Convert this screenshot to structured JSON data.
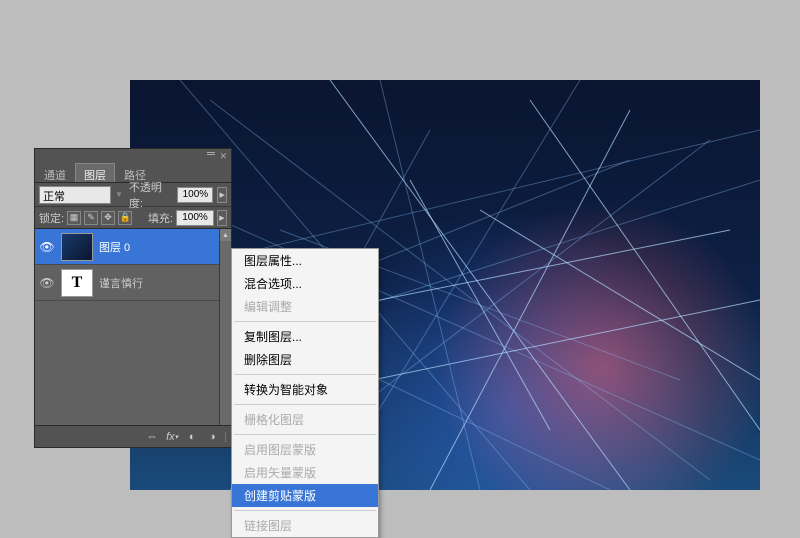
{
  "panel": {
    "tabs": [
      {
        "label": "通道",
        "active": false
      },
      {
        "label": "图层",
        "active": true
      },
      {
        "label": "路径",
        "active": false
      }
    ],
    "blend_mode": "正常",
    "opacity_label": "不透明度:",
    "opacity_value": "100%",
    "lock_label": "锁定:",
    "fill_label": "填充:",
    "fill_value": "100%",
    "layers": [
      {
        "name": "图层 0",
        "type": "image",
        "selected": true,
        "visible": true
      },
      {
        "name": "谨言慎行",
        "type": "text",
        "selected": false,
        "visible": true,
        "glyph": "T"
      }
    ],
    "bottom_icons": [
      "link-icon",
      "fx-icon",
      "mask-icon",
      "adjustment-icon"
    ]
  },
  "context_menu": {
    "groups": [
      [
        {
          "label": "图层属性...",
          "disabled": false
        },
        {
          "label": "混合选项...",
          "disabled": false
        },
        {
          "label": "编辑调整",
          "disabled": true
        }
      ],
      [
        {
          "label": "复制图层...",
          "disabled": false
        },
        {
          "label": "删除图层",
          "disabled": false
        }
      ],
      [
        {
          "label": "转换为智能对象",
          "disabled": false
        }
      ],
      [
        {
          "label": "栅格化图层",
          "disabled": true
        }
      ],
      [
        {
          "label": "启用图层蒙版",
          "disabled": true
        },
        {
          "label": "启用矢量蒙版",
          "disabled": true
        },
        {
          "label": "创建剪贴蒙版",
          "disabled": false,
          "highlight": true
        }
      ],
      [
        {
          "label": "链接图层",
          "disabled": true
        }
      ]
    ]
  }
}
